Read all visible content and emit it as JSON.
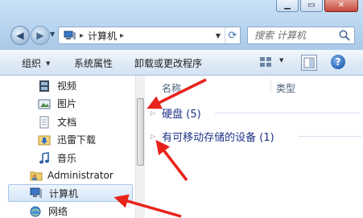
{
  "address_bar": {
    "crumb": "计算机"
  },
  "search": {
    "placeholder": "搜索 计算机"
  },
  "toolbar": {
    "organize_label": "组织",
    "system_properties_label": "系统属性",
    "uninstall_label": "卸载或更改程序",
    "help_label": "?"
  },
  "sidebar": {
    "items": [
      {
        "label": "视频",
        "icon": "video-icon"
      },
      {
        "label": "图片",
        "icon": "picture-icon"
      },
      {
        "label": "文档",
        "icon": "document-icon"
      },
      {
        "label": "迅雷下载",
        "icon": "thunder-download-icon"
      },
      {
        "label": "音乐",
        "icon": "music-icon"
      },
      {
        "label": "Administrator",
        "icon": "user-folder-icon"
      },
      {
        "label": "计算机",
        "icon": "computer-icon",
        "selected": true
      },
      {
        "label": "网络",
        "icon": "network-icon"
      }
    ]
  },
  "content": {
    "columns": [
      "名称",
      "类型"
    ],
    "groups": [
      {
        "label": "硬盘 (5)"
      },
      {
        "label": "有可移动存储的设备 (1)"
      }
    ]
  },
  "colors": {
    "annotation_arrow": "#e8231b",
    "selection": "#d5e6f8",
    "group_text": "#1e3287"
  }
}
